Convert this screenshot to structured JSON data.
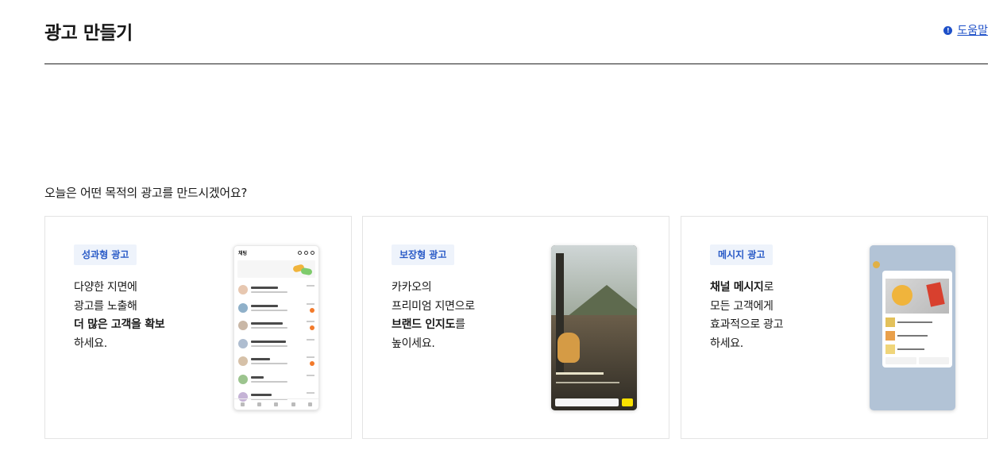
{
  "header": {
    "title": "광고 만들기",
    "help_icon": "!",
    "help_label": "도움말"
  },
  "question": "오늘은 어떤 목적의 광고를 만드시겠어요?",
  "cards": [
    {
      "badge": "성과형 광고",
      "lines": [
        "다양한 지면에",
        "광고를 노출해"
      ],
      "bold": "더 많은 고객을 확보",
      "after_bold": "",
      "last": "하세요."
    },
    {
      "badge": "보장형 광고",
      "lines": [
        "카카오의",
        "프리미엄 지면으로"
      ],
      "bold": "브랜드 인지도",
      "after_bold": "를",
      "last": "높이세요."
    },
    {
      "badge": "메시지 광고",
      "lines": [],
      "bold": "채널 메시지",
      "after_bold": "로",
      "extra_lines": [
        "모든 고객에게",
        "효과적으로 광고"
      ],
      "last": "하세요."
    }
  ],
  "phone1": {
    "title": "채팅"
  },
  "colors": {
    "accent": "#1e50c8",
    "badge_bg": "#eef3fb",
    "badge_text": "#2a5bc7"
  }
}
